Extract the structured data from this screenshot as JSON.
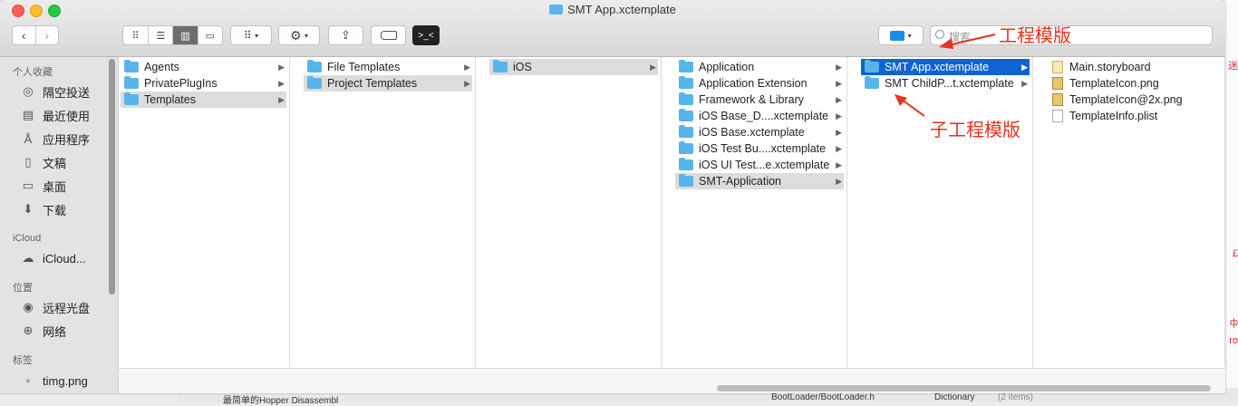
{
  "window": {
    "title": "SMT App.xctemplate"
  },
  "toolbar": {
    "action_symbol": ">_<"
  },
  "search": {
    "placeholder": "搜索"
  },
  "sidebar": {
    "sections": [
      {
        "title": "个人收藏",
        "items": [
          "隔空投送",
          "最近使用",
          "应用程序",
          "文稿",
          "桌面",
          "下载"
        ]
      },
      {
        "title": "iCloud",
        "items": [
          "iCloud..."
        ]
      },
      {
        "title": "位置",
        "items": [
          "远程光盘",
          "网络"
        ]
      },
      {
        "title": "标签",
        "items": [
          "timg.png"
        ]
      }
    ]
  },
  "columns": [
    {
      "items": [
        "Agents",
        "PrivatePlugIns",
        "Templates"
      ],
      "selected": 2
    },
    {
      "items": [
        "File Templates",
        "Project Templates"
      ],
      "selected": 1
    },
    {
      "items": [
        "iOS"
      ],
      "selected": 0
    },
    {
      "items": [
        "Application",
        "Application Extension",
        "Framework & Library",
        "iOS Base_D....xctemplate",
        "iOS Base.xctemplate",
        "iOS Test Bu....xctemplate",
        "iOS UI Test...e.xctemplate",
        "SMT-Application"
      ],
      "selected": 7
    },
    {
      "items": [
        "SMT App.xctemplate",
        "SMT ChildP...t.xctemplate"
      ],
      "selected": 0
    },
    {
      "items": [
        "Main.storyboard",
        "TemplateIcon.png",
        "TemplateIcon@2x.png",
        "TemplateInfo.plist"
      ]
    }
  ],
  "annotations": {
    "project_template": "工程模版",
    "child_template": "子工程模版"
  },
  "background": {
    "bottom_texts": [
      "最简单的Hopper Disassembl",
      "BootLoader/BootLoader.h",
      "Dictionary",
      "(2 items)"
    ]
  },
  "colors": {
    "selection_blue": "#0f64d2",
    "folder_blue": "#58b5ec",
    "annotation_red": "#e8321f"
  }
}
